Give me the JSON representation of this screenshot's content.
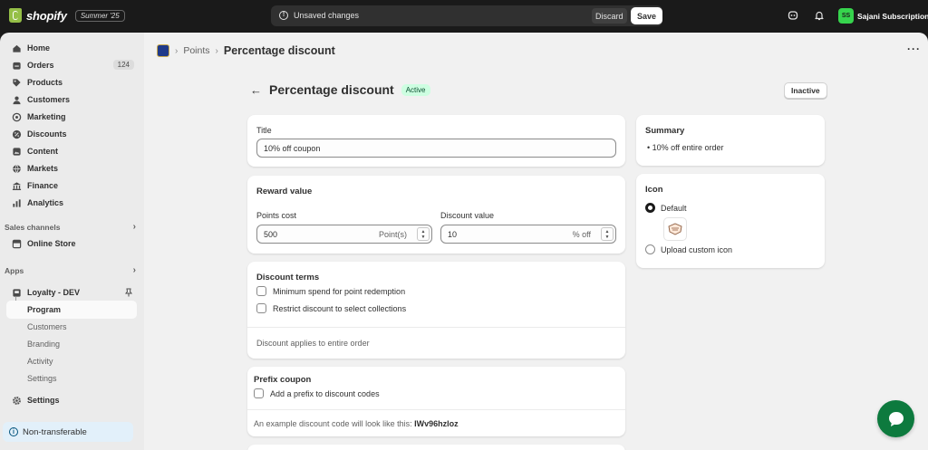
{
  "topbar": {
    "logo_text": "shopify",
    "edition": "Summer '25",
    "savebar_text": "Unsaved changes",
    "discard_label": "Discard",
    "save_label": "Save",
    "user_initials": "SS",
    "user_name": "Sajani Subscription",
    "avatar_color": "#36d44d"
  },
  "sidebar": {
    "items": [
      {
        "label": "Home",
        "icon": "home-icon"
      },
      {
        "label": "Orders",
        "icon": "orders-icon",
        "badge": "124"
      },
      {
        "label": "Products",
        "icon": "tag-icon"
      },
      {
        "label": "Customers",
        "icon": "person-icon"
      },
      {
        "label": "Marketing",
        "icon": "target-icon"
      },
      {
        "label": "Discounts",
        "icon": "discount-icon"
      },
      {
        "label": "Content",
        "icon": "content-icon"
      },
      {
        "label": "Markets",
        "icon": "globe-icon"
      },
      {
        "label": "Finance",
        "icon": "bank-icon"
      },
      {
        "label": "Analytics",
        "icon": "chart-icon"
      }
    ],
    "sales_channels_label": "Sales channels",
    "online_store_label": "Online Store",
    "apps_label": "Apps",
    "app_name": "Loyalty - DEV",
    "app_subitems": [
      "Program",
      "Customers",
      "Branding",
      "Activity",
      "Settings"
    ],
    "settings_label": "Settings",
    "non_transferable_label": "Non-transferable"
  },
  "breadcrumb": {
    "parent": "Points",
    "separator": "›",
    "current": "Percentage discount"
  },
  "page": {
    "title": "Percentage discount",
    "status_badge": "Active",
    "inactive_button": "Inactive"
  },
  "title_card": {
    "label": "Title",
    "value": "10% off coupon"
  },
  "reward_card": {
    "heading": "Reward value",
    "points_cost_label": "Points cost",
    "points_cost_value": "500",
    "points_suffix": "Point(s)",
    "discount_value_label": "Discount value",
    "discount_value": "10",
    "discount_suffix": "% off"
  },
  "terms_card": {
    "heading": "Discount terms",
    "option1": "Minimum spend for point redemption",
    "option2": "Restrict discount to select collections",
    "footer": "Discount applies to entire order"
  },
  "prefix_card": {
    "heading": "Prefix coupon",
    "option": "Add a prefix to discount codes",
    "example_text": "An example discount code will look like this:",
    "example_code": "IWv96hzloz"
  },
  "summary_card": {
    "heading": "Summary",
    "bullet": "10% off entire order"
  },
  "icon_card": {
    "heading": "Icon",
    "default_label": "Default",
    "upload_label": "Upload custom icon"
  }
}
